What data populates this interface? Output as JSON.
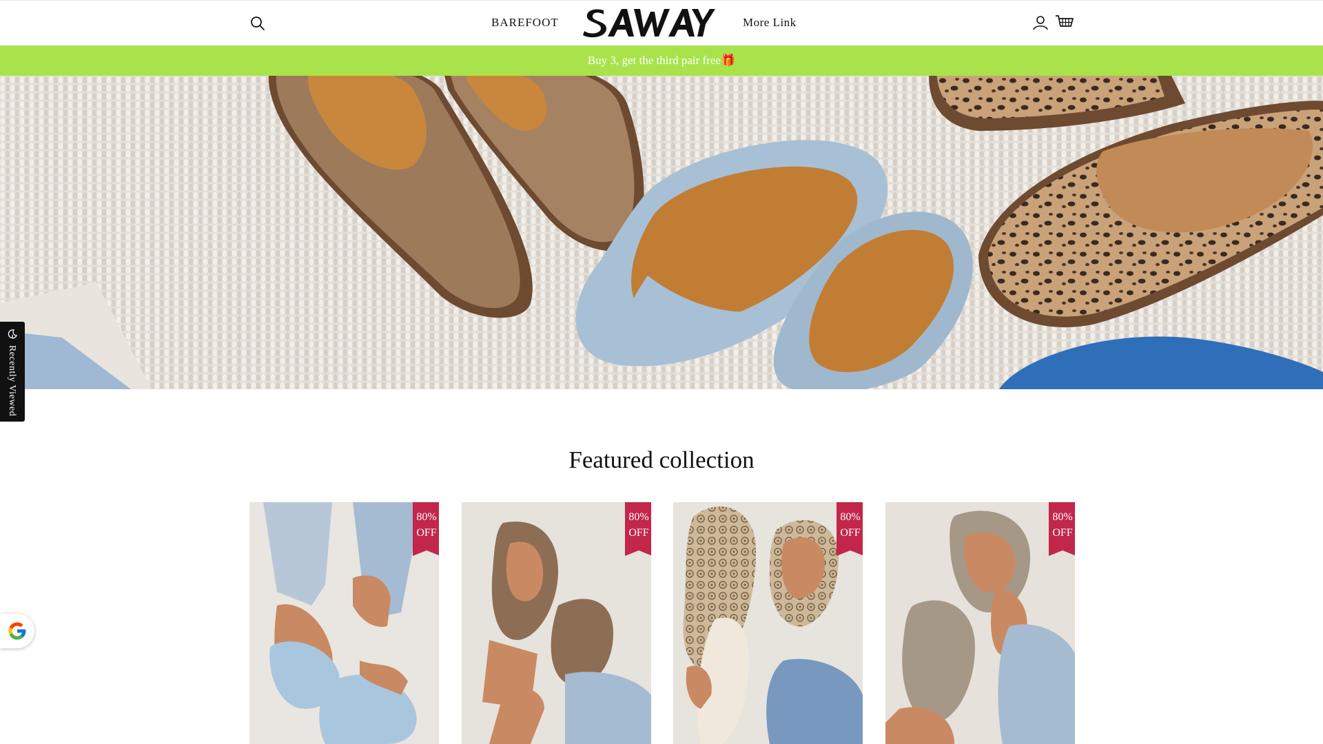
{
  "header": {
    "nav_left": "BAREFOOT",
    "nav_right": "More Link",
    "logo_text": "SAWAY",
    "icons": [
      "search-icon",
      "account-icon",
      "cart-icon"
    ]
  },
  "announcement": {
    "text": "Buy 3, get the third pair free",
    "emoji": "🎁",
    "bg_color": "#a9e34b"
  },
  "side_tab": {
    "label": "Recently Viewed"
  },
  "featured": {
    "title": "Featured collection",
    "products": [
      {
        "badge_pct": "80%",
        "badge_off": "OFF",
        "shoe_color": "#a9c6df"
      },
      {
        "badge_pct": "80%",
        "badge_off": "OFF",
        "shoe_color": "#8d6e55"
      },
      {
        "badge_pct": "80%",
        "badge_off": "OFF",
        "shoe_color": "#cdb999"
      },
      {
        "badge_pct": "80%",
        "badge_off": "OFF",
        "shoe_color": "#a69887"
      }
    ],
    "badge_color": "#c2264b"
  }
}
